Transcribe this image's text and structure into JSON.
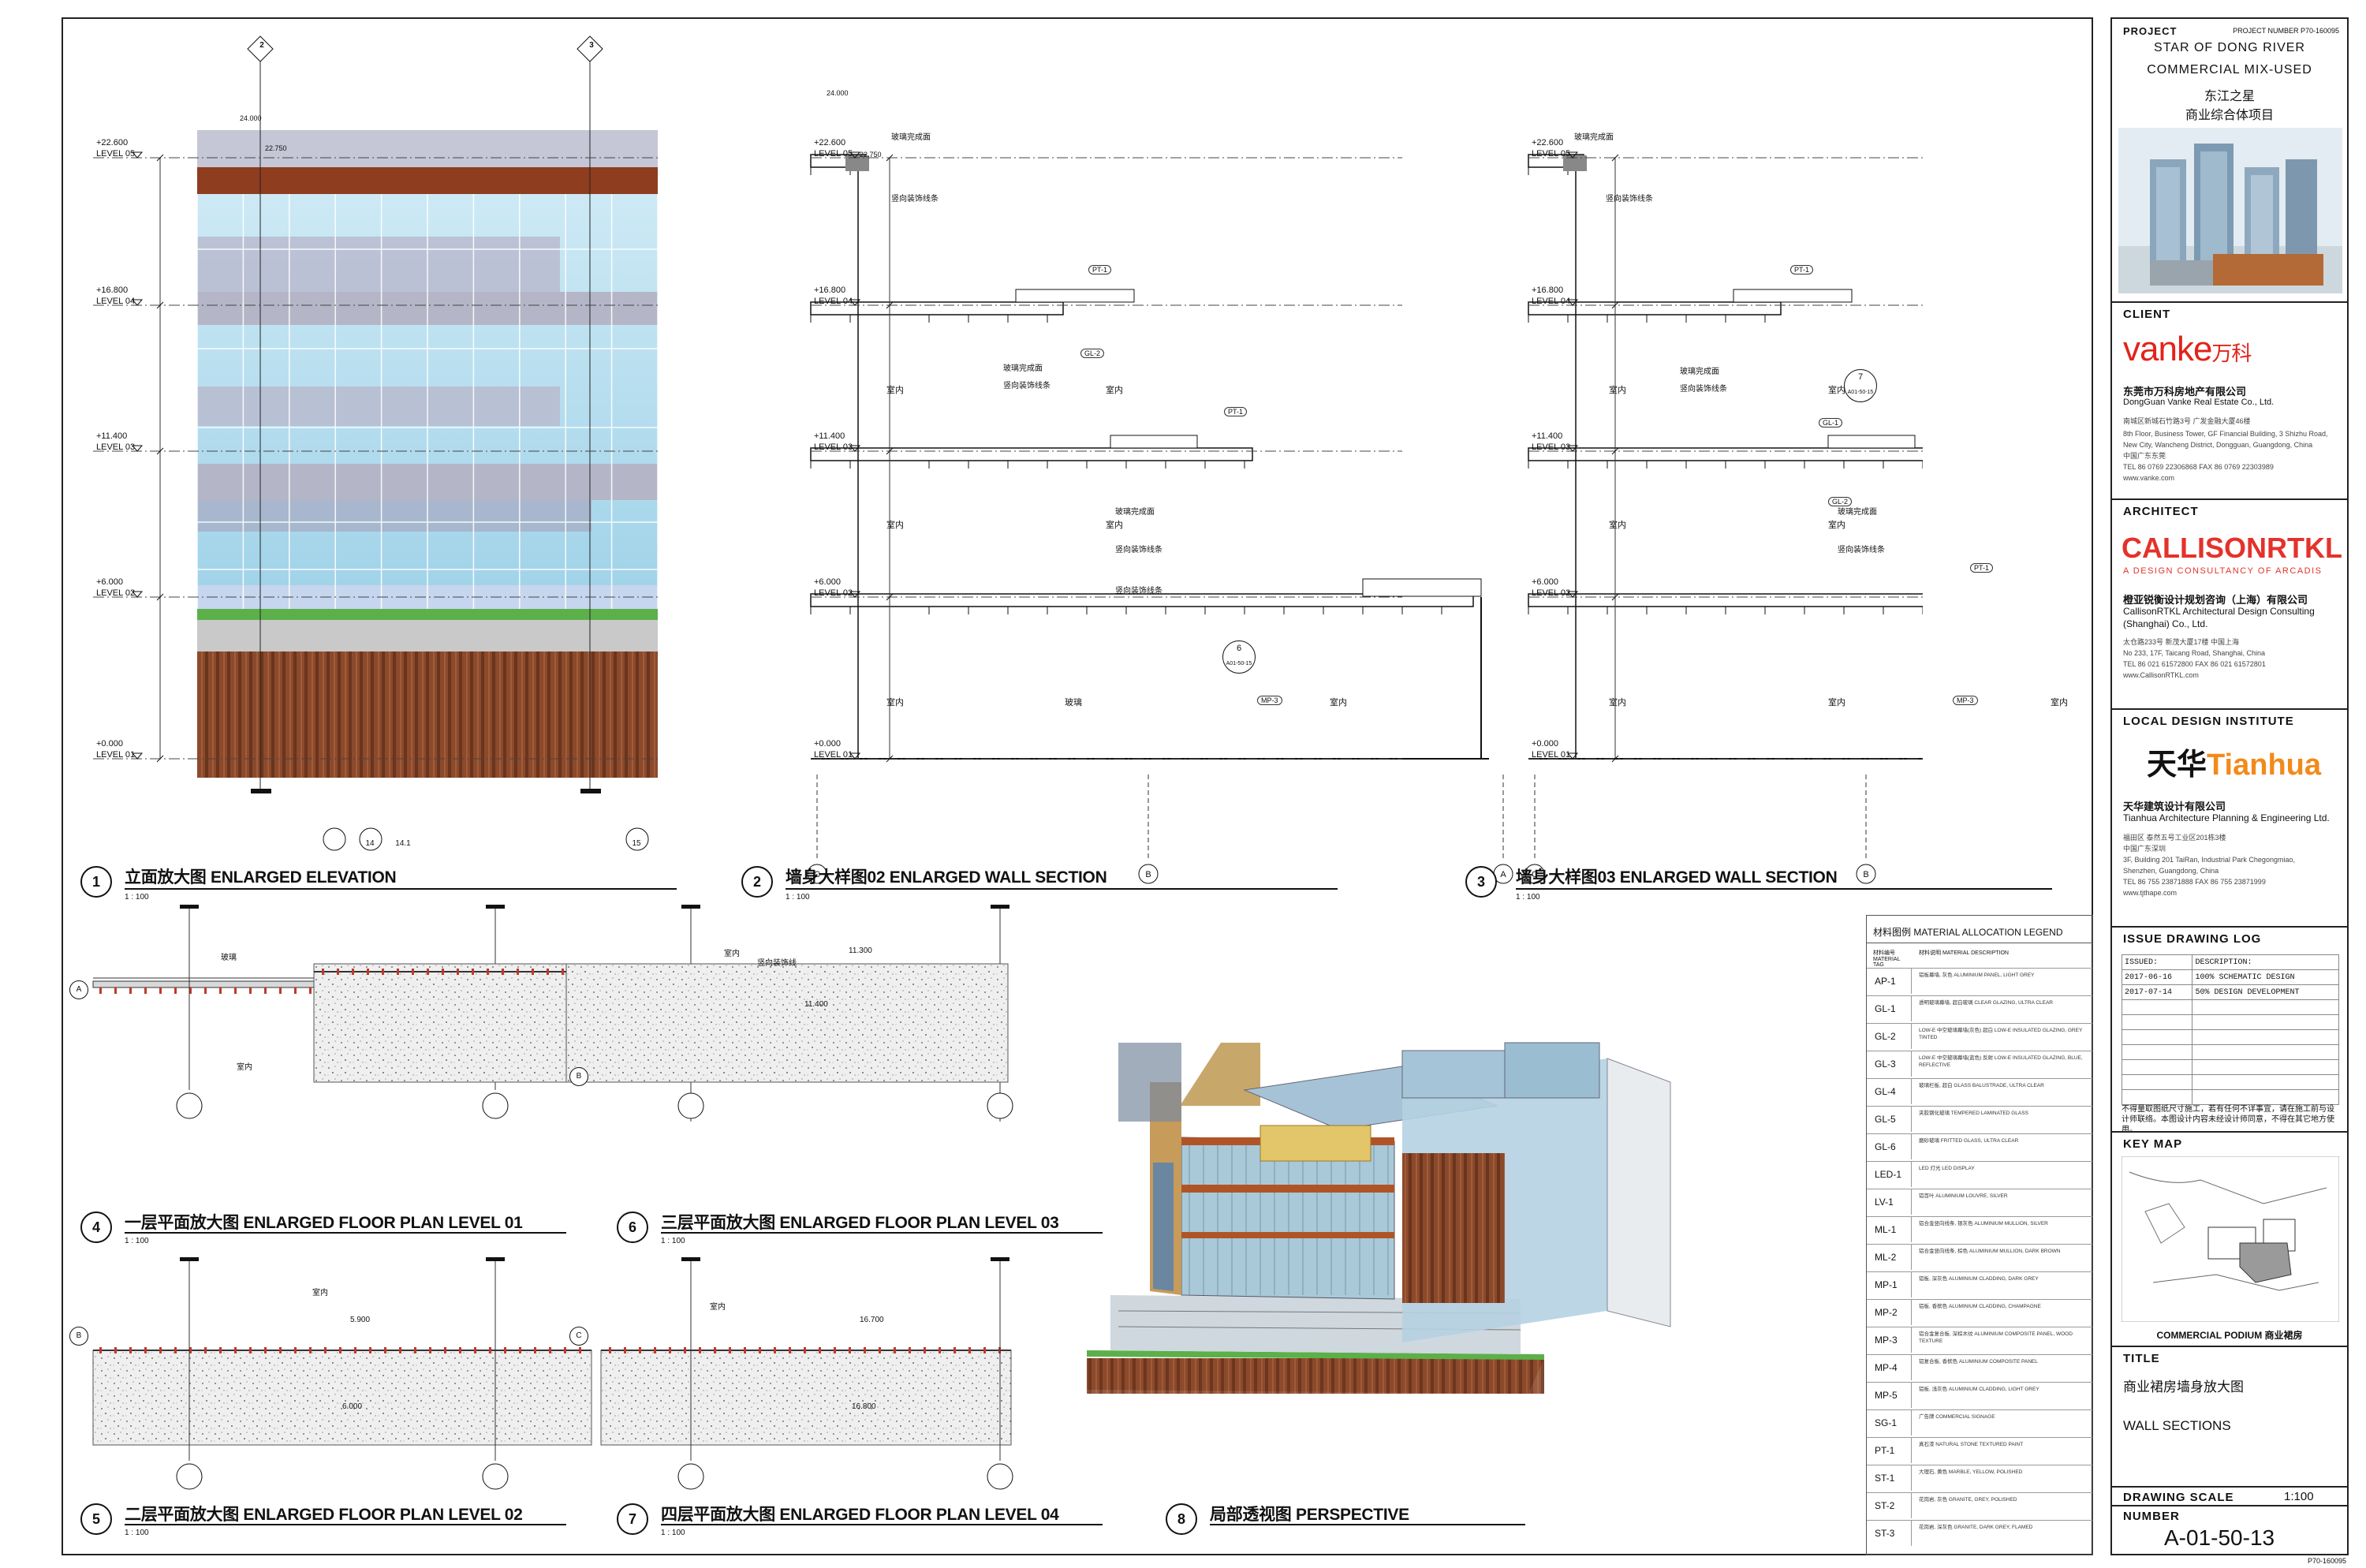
{
  "views": [
    {
      "num": "1",
      "title": "立面放大图 ENLARGED ELEVATION",
      "scale": "1 : 100"
    },
    {
      "num": "2",
      "title": "墙身大样图02 ENLARGED WALL SECTION",
      "scale": "1 : 100"
    },
    {
      "num": "3",
      "title": "墙身大样图03 ENLARGED WALL SECTION",
      "scale": "1 : 100"
    },
    {
      "num": "4",
      "title": "一层平面放大图 ENLARGED FLOOR PLAN LEVEL 01",
      "scale": "1 : 100"
    },
    {
      "num": "6",
      "title": "三层平面放大图 ENLARGED FLOOR PLAN LEVEL 03",
      "scale": "1 : 100"
    },
    {
      "num": "5",
      "title": "二层平面放大图 ENLARGED FLOOR PLAN LEVEL 02",
      "scale": "1 : 100"
    },
    {
      "num": "7",
      "title": "四层平面放大图 ENLARGED FLOOR PLAN LEVEL 04",
      "scale": "1 : 100"
    },
    {
      "num": "8",
      "title": "局部透视图 PERSPECTIVE",
      "scale": ""
    }
  ],
  "levels": [
    {
      "value": "+22.600",
      "name": "LEVEL 05"
    },
    {
      "value": "+16.800",
      "name": "LEVEL 04"
    },
    {
      "value": "+11.400",
      "name": "LEVEL 03"
    },
    {
      "value": "+6.000",
      "name": "LEVEL 02"
    },
    {
      "value": "+0.000",
      "name": "LEVEL 01"
    }
  ],
  "elevation_annotations": {
    "top_a": "24.000",
    "top_b": "22.750",
    "grid_top": [
      "2",
      "3"
    ],
    "grid_bottom": [
      "14",
      "14.1",
      "15"
    ],
    "section_ref": "A01-50-13"
  },
  "section_grids": [
    "C",
    "B",
    "A"
  ],
  "section_labels": {
    "interior": "室内",
    "glass": "玻璃",
    "glass_finish": "玻璃完成面",
    "vertical_deco": "竖向装饰线条",
    "tags": [
      "PT-1",
      "GL-2",
      "PT-1",
      "MP-3"
    ],
    "detail_6": "6",
    "detail_7": "7",
    "detail_ref": "A01-50-15",
    "gl1": "GL-1",
    "top_dim": "24.000",
    "top_dim2": "22.750"
  },
  "plan_labels": {
    "p4": {
      "grid": "A",
      "top_text": "玻璃",
      "bottom_text": "室内"
    },
    "p6": {
      "grid": "B",
      "text_a": "室内",
      "text_b": "竖向装饰线",
      "dim": "11.300",
      "dim2": "11.400"
    },
    "p5": {
      "grid": "B",
      "text_a": "室内",
      "dim": "5.900",
      "dim2": "6.000"
    },
    "p7": {
      "grid": "C",
      "text_a": "室内",
      "dim": "16.700",
      "dim2": "16.800"
    }
  },
  "legend": {
    "title": "材料图例  MATERIAL ALLOCATION LEGEND",
    "col_a": "材料编号 MATERIAL TAG",
    "col_b": "材料说明 MATERIAL DESCRIPTION",
    "items": [
      {
        "code": "AP-1",
        "desc": "铝板幕墙, 灰色 ALUMINIUM PANEL, LIGHT GREY"
      },
      {
        "code": "GL-1",
        "desc": "透明玻璃幕墙, 超白玻璃 CLEAR GLAZING, ULTRA CLEAR"
      },
      {
        "code": "GL-2",
        "desc": "LOW-E 中空玻璃幕墙(灰色) 超白 LOW-E INSULATED GLAZING, GREY TINTED"
      },
      {
        "code": "GL-3",
        "desc": "LOW-E 中空玻璃幕墙(蓝色) 反射 LOW-E INSULATED GLAZING, BLUE, REFLECTIVE"
      },
      {
        "code": "GL-4",
        "desc": "玻璃栏板, 超白 GLASS BALUSTRADE, ULTRA CLEAR"
      },
      {
        "code": "GL-5",
        "desc": "夹胶钢化玻璃 TEMPERED LAMINATED GLASS"
      },
      {
        "code": "GL-6",
        "desc": "磨砂玻璃 FRITTED GLASS, ULTRA CLEAR"
      },
      {
        "code": "LED-1",
        "desc": "LED 灯光 LED DISPLAY"
      },
      {
        "code": "LV-1",
        "desc": "铝百叶 ALUMINIUM LOUVRE, SILVER"
      },
      {
        "code": "ML-1",
        "desc": "铝合金竖向线条, 银灰色 ALUMINIUM MULLION, SILVER"
      },
      {
        "code": "ML-2",
        "desc": "铝合金竖向线条, 棕色 ALUMINIUM MULLION, DARK BROWN"
      },
      {
        "code": "MP-1",
        "desc": "铝板, 深灰色 ALUMINIUM CLADDING, DARK GREY"
      },
      {
        "code": "MP-2",
        "desc": "铝板, 香槟色 ALUMINIUM CLADDING, CHAMPAGNE"
      },
      {
        "code": "MP-3",
        "desc": "铝合金复合板, 深棕木纹 ALUMINIUM COMPOSITE PANEL, WOOD TEXTURE"
      },
      {
        "code": "MP-4",
        "desc": "铝复合板, 香槟色 ALUMINIUM COMPOSITE PANEL"
      },
      {
        "code": "MP-5",
        "desc": "铝板, 浅灰色 ALUMINIUM CLADDING, LIGHT GREY"
      },
      {
        "code": "SG-1",
        "desc": "广告牌 COMMERCIAL SIGNAGE"
      },
      {
        "code": "PT-1",
        "desc": "真石漆 NATURAL STONE TEXTURED PAINT"
      },
      {
        "code": "ST-1",
        "desc": "大理石, 黄色 MARBLE, YELLOW, POLISHED"
      },
      {
        "code": "ST-2",
        "desc": "花岗岩, 灰色 GRANITE, GREY, POLISHED"
      },
      {
        "code": "ST-3",
        "desc": "花岗岩, 深灰色 GRANITE, DARK GREY, FLAMED"
      }
    ]
  },
  "titleblock": {
    "project_label": "PROJECT",
    "project_number": "PROJECT NUMBER P70-160095",
    "project_en1": "STAR OF DONG RIVER",
    "project_en2": "COMMERCIAL MIX-USED",
    "project_cn1": "东江之星",
    "project_cn2": "商业综合体项目",
    "client_label": "CLIENT",
    "client_logo": "vanke",
    "client_logo_cn": "万科",
    "client_cn": "东莞市万科房地产有限公司",
    "client_en": "DongGuan Vanke Real Estate Co., Ltd.",
    "client_addr_cn": "南城区新城石竹路3号 广发金融大厦46楼",
    "client_addr1": "8th Floor, Business Tower, GF Financial Building, 3 Shizhu Road,",
    "client_addr2": "New City, Wancheng District, Dongguan, Guangdong, China",
    "client_addr3": "中国广东东莞",
    "client_tel": "TEL 86 0769 22306868    FAX 86 0769 22303989",
    "client_web": "www.vanke.com",
    "architect_label": "ARCHITECT",
    "architect_logo": "CALLISONRTKL",
    "architect_tagline": "A DESIGN CONSULTANCY OF ARCADIS",
    "architect_cn": "橙亚锐衡设计规划咨询（上海）有限公司",
    "architect_en1": "CallisonRTKL Architectural Design Consulting",
    "architect_en2": "(Shanghai) Co., Ltd.",
    "architect_addr_cn": "太仓路233号 新茂大厦17楼  中国上海",
    "architect_addr": "No 233, 17F, Taicang Road, Shanghai, China",
    "architect_tel": "TEL 86 021 61572800    FAX 86 021 61572801",
    "architect_web": "www.CallisonRTKL.com",
    "ldi_label": "LOCAL DESIGN INSTITUTE",
    "ldi_logo_cn": "天华",
    "ldi_logo_en": "Tianhua",
    "ldi_cn": "天华建筑设计有限公司",
    "ldi_en": "Tianhua Architecture Planning & Engineering Ltd.",
    "ldi_addr_cn": "福田区  泰然五号工业区201栋3楼",
    "ldi_addr1": "中国广东深圳",
    "ldi_addr2": "3F, Building 201 TaiRan, Industrial Park Chegongmiao,",
    "ldi_addr3": "Shenzhen, Guangdong, China",
    "ldi_tel": "TEL 86 755 23871888    FAX 86 755 23871999",
    "ldi_web": "www.tjthape.com",
    "issue_label": "ISSUE DRAWING LOG",
    "issue_cols": [
      "ISSUED:",
      "DESCRIPTION:"
    ],
    "issue_rows": [
      [
        "2017-06-16",
        "100% SCHEMATIC DESIGN"
      ],
      [
        "2017-07-14",
        "50% DESIGN DEVELOPMENT"
      ]
    ],
    "note_cn": "不得量取图纸尺寸施工，若有任何不详事宜，请在施工前与设计师联络。本图设计内容未经设计师同意，不得在其它地方使用。",
    "keymap_label": "KEY MAP",
    "keymap_caption": "COMMERCIAL PODIUM 商业裙房",
    "title_label": "TITLE",
    "title_cn": "商业裙房墙身放大图",
    "title_en": "WALL SECTIONS",
    "scale_label": "DRAWING SCALE",
    "scale_value": "1:100",
    "number_label": "NUMBER",
    "number_value": "A-01-50-13",
    "footer": "P70-160095"
  },
  "colors": {
    "glass": "#a9d8ea",
    "spandrel": "#b4b6c8",
    "wood": "#8e4a2a",
    "copper": "#b05428",
    "green": "#5cb04a",
    "concrete": "#c9c9c9",
    "vanke_red": "#e2231a",
    "callison_red": "#e4322b",
    "tianhua_orange": "#f28a1a"
  }
}
